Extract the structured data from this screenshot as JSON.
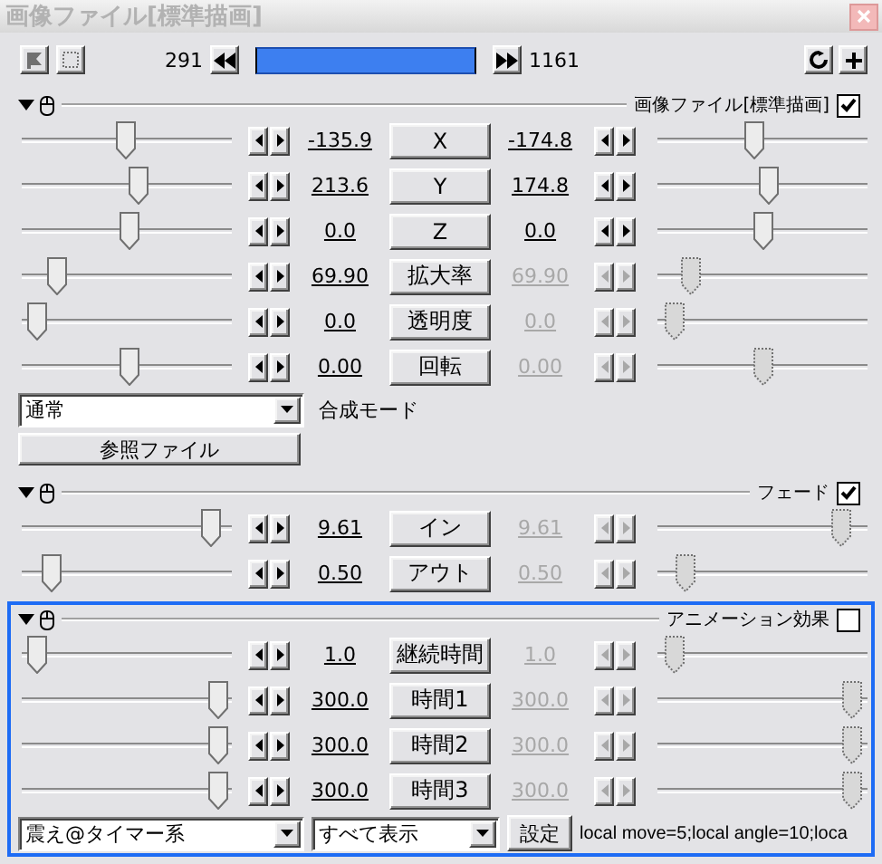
{
  "window": {
    "title": "画像ファイル[標準描画]"
  },
  "timeline": {
    "start": "291",
    "end": "1161"
  },
  "sections": [
    {
      "title": "画像ファイル[標準描画]",
      "checked": true,
      "selected": false,
      "tracks": [
        {
          "label": "X",
          "right_enabled": true,
          "left": {
            "value": "-135.9",
            "level": 0.5
          },
          "right": {
            "value": "-174.8",
            "level": 0.46
          }
        },
        {
          "label": "Y",
          "right_enabled": true,
          "left": {
            "value": "213.6",
            "level": 0.57
          },
          "right": {
            "value": "174.8",
            "level": 0.54
          }
        },
        {
          "label": "Z",
          "right_enabled": true,
          "left": {
            "value": "0.0",
            "level": 0.52
          },
          "right": {
            "value": "0.0",
            "level": 0.51
          }
        },
        {
          "label": "拡大率",
          "right_enabled": false,
          "left": {
            "value": "69.90",
            "level": 0.13
          },
          "right": {
            "value": "69.90",
            "level": 0.12
          }
        },
        {
          "label": "透明度",
          "right_enabled": false,
          "left": {
            "value": "0.0",
            "level": 0.02
          },
          "right": {
            "value": "0.0",
            "level": 0.03
          }
        },
        {
          "label": "回転",
          "right_enabled": false,
          "left": {
            "value": "0.00",
            "level": 0.52
          },
          "right": {
            "value": "0.00",
            "level": 0.51
          }
        }
      ],
      "footer_rows": [
        [
          {
            "kind": "combo",
            "text": "通常"
          },
          {
            "kind": "label",
            "text": "合成モード"
          }
        ],
        [
          {
            "kind": "button",
            "text": "参照ファイル"
          }
        ]
      ]
    },
    {
      "title": "フェード",
      "checked": true,
      "selected": false,
      "tracks": [
        {
          "label": "イン",
          "right_enabled": false,
          "left": {
            "value": "9.61",
            "level": 0.96
          },
          "right": {
            "value": "9.61",
            "level": 0.93
          }
        },
        {
          "label": "アウト",
          "right_enabled": false,
          "left": {
            "value": "0.50",
            "level": 0.1
          },
          "right": {
            "value": "0.50",
            "level": 0.09
          }
        }
      ]
    },
    {
      "title": "アニメーション効果",
      "checked": false,
      "selected": true,
      "tracks": [
        {
          "label": "継続時間",
          "right_enabled": false,
          "left": {
            "value": "1.0",
            "level": 0.02
          },
          "right": {
            "value": "1.0",
            "level": 0.03
          }
        },
        {
          "label": "時間1",
          "right_enabled": false,
          "left": {
            "value": "300.0",
            "level": 1
          },
          "right": {
            "value": "300.0",
            "level": 0.99
          }
        },
        {
          "label": "時間2",
          "right_enabled": false,
          "left": {
            "value": "300.0",
            "level": 1
          },
          "right": {
            "value": "300.0",
            "level": 0.99
          }
        },
        {
          "label": "時間3",
          "right_enabled": false,
          "left": {
            "value": "300.0",
            "level": 1
          },
          "right": {
            "value": "300.0",
            "level": 0.99
          }
        }
      ],
      "footer_rows": [
        [
          {
            "kind": "combo",
            "text": "震え@タイマー系"
          },
          {
            "kind": "combo",
            "text": "すべて表示"
          },
          {
            "kind": "button",
            "text": "設定"
          },
          {
            "kind": "text",
            "text": "local move=5;local angle=10;loca"
          }
        ]
      ]
    }
  ]
}
